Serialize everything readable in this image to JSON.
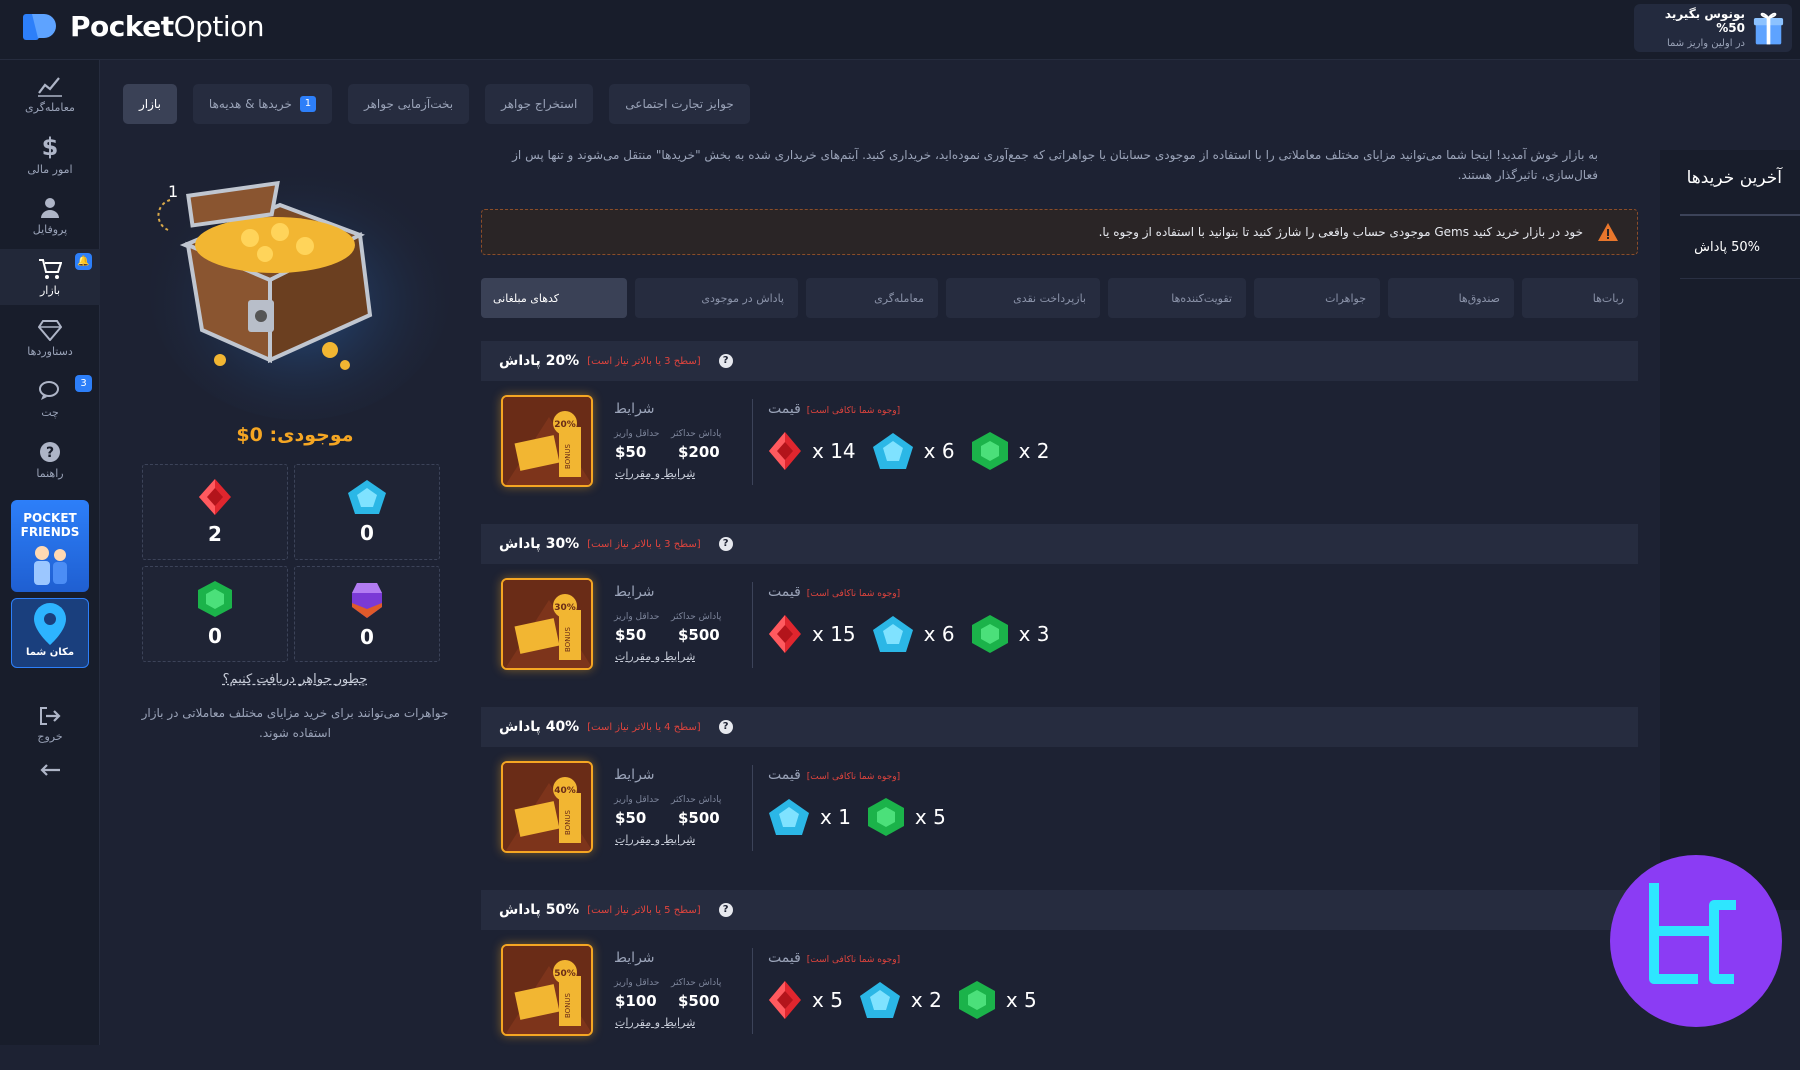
{
  "header": {
    "logo_bold": "Pocket",
    "logo_light": "Option",
    "bonus_title": "بونوس بگیرید 50%",
    "bonus_sub": "در اولین واریز شما"
  },
  "sidebar": {
    "items": [
      {
        "label": "معامله‌گری",
        "icon": "chart-icon"
      },
      {
        "label": "امور مالی",
        "icon": "dollar-icon"
      },
      {
        "label": "پروفایل",
        "icon": "user-icon"
      },
      {
        "label": "بازار",
        "icon": "cart-icon",
        "badge": "🔔"
      },
      {
        "label": "دستاوردها",
        "icon": "diamond-icon"
      },
      {
        "label": "چت",
        "icon": "chat-icon",
        "badge": "3"
      },
      {
        "label": "راهنما",
        "icon": "help-icon"
      },
      {
        "label": "خروج",
        "icon": "logout-icon"
      }
    ],
    "friends_title": "POCKET FRIENDS",
    "location_label": "مکان شما"
  },
  "tabs": [
    {
      "label": "بازار",
      "active": true
    },
    {
      "label": "خریدها & هدیه‌ها",
      "count": "1"
    },
    {
      "label": "بخت‌آزمایی جواهر"
    },
    {
      "label": "استخراج جواهر"
    },
    {
      "label": "جوایز تجارت اجتماعی"
    }
  ],
  "left": {
    "level": "1",
    "balance": "موجودی: 0$",
    "gems": [
      {
        "name": "red-gem",
        "count": "2",
        "color": "#e0262e"
      },
      {
        "name": "blue-gem",
        "count": "0",
        "color": "#2bb7e6"
      },
      {
        "name": "green-gem",
        "count": "0",
        "color": "#1bb34a"
      },
      {
        "name": "purple-gem",
        "count": "0",
        "color": "#7a3ad6"
      }
    ],
    "how_link": "چطور جواهر دریافت کنیم؟",
    "how_desc": "جواهرات می‌توانند برای خرید مزایای مختلف معاملاتی در بازار استفاده شوند."
  },
  "intro": "به بازار خوش آمدید! اینجا شما می‌توانید مزایای مختلف معاملاتی را با استفاده از موجودی حسابتان یا جواهراتی که جمع‌آوری نموده‌اید، خریداری کنید. آیتم‌های خریداری شده به بخش \"خریدها\" منتقل می‌شوند و تنها پس از فعال‌سازی، تاثیرگذار هستند.",
  "warning": "خود در بازار خرید کنید Gems موجودی حساب واقعی را شارژ کنید تا بتوانید با استفاده از وجوه یا.",
  "filters": [
    {
      "label": "ربات‌ها"
    },
    {
      "label": "صندوق‌ها"
    },
    {
      "label": "جواهرات"
    },
    {
      "label": "تقویت‌کننده‌ها"
    },
    {
      "label": "بازپرداخت نقدی"
    },
    {
      "label": "معامله‌گری"
    },
    {
      "label": "پاداش در موجودی"
    },
    {
      "label": "کدهای مبلغانی",
      "active": true
    }
  ],
  "offers": [
    {
      "pct": "20% پاداش",
      "level": "[سطح 3 یا بالاتر نیاز است]",
      "badge": "20%",
      "min_deposit": "$50",
      "max_bonus": "$200",
      "price": [
        {
          "gem": "red",
          "qty": "x 14"
        },
        {
          "gem": "blue",
          "qty": "x 6"
        },
        {
          "gem": "green",
          "qty": "x 2"
        }
      ]
    },
    {
      "pct": "30% پاداش",
      "level": "[سطح 3 یا بالاتر نیاز است]",
      "badge": "30%",
      "min_deposit": "$50",
      "max_bonus": "$500",
      "price": [
        {
          "gem": "red",
          "qty": "x 15"
        },
        {
          "gem": "blue",
          "qty": "x 6"
        },
        {
          "gem": "green",
          "qty": "x 3"
        }
      ]
    },
    {
      "pct": "40% پاداش",
      "level": "[سطح 4 یا بالاتر نیاز است]",
      "badge": "40%",
      "min_deposit": "$50",
      "max_bonus": "$500",
      "price": [
        {
          "gem": "blue",
          "qty": "x 1"
        },
        {
          "gem": "green",
          "qty": "x 5"
        }
      ]
    },
    {
      "pct": "50% پاداش",
      "level": "[سطح 5 یا بالاتر نیاز است]",
      "badge": "50%",
      "min_deposit": "$100",
      "max_bonus": "$500",
      "price": [
        {
          "gem": "red",
          "qty": "x 5"
        },
        {
          "gem": "blue",
          "qty": "x 2"
        },
        {
          "gem": "green",
          "qty": "x 5"
        }
      ]
    }
  ],
  "offer_labels": {
    "conditions": "شرایط",
    "min_deposit": "حداقل واریز",
    "max_bonus": "پاداش حداکثر",
    "terms": "شرایط و مقررات",
    "price": "قیمت",
    "price_note": "[وجوه شما ناکافی است]",
    "bonus_word": "BONUS"
  },
  "recent": {
    "title": "آخرین خریدها",
    "items": [
      "50% پاداش"
    ]
  },
  "colors": {
    "accent": "#2d7ff9",
    "orange": "#f5a623",
    "danger": "#e0443d",
    "brand_circle": "#8b3cf4"
  }
}
